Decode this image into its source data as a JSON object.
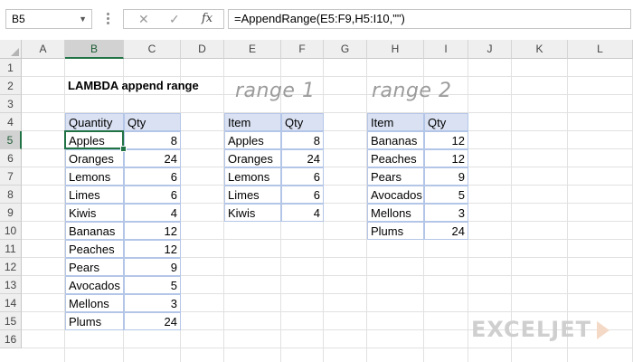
{
  "formula_bar": {
    "name_box": "B5",
    "cancel": "✕",
    "enter": "✓",
    "fx": "fx",
    "formula": "=AppendRange(E5:F9,H5:I10,\"\")"
  },
  "sheet": {
    "columns": [
      "A",
      "B",
      "C",
      "D",
      "E",
      "F",
      "G",
      "H",
      "I",
      "J",
      "K",
      "L"
    ],
    "rows": [
      "1",
      "2",
      "3",
      "4",
      "5",
      "6",
      "7",
      "8",
      "9",
      "10",
      "11",
      "12",
      "13",
      "14",
      "15",
      "16"
    ],
    "selected_column": "B",
    "selected_row": "5",
    "title": "LAMBDA append range",
    "range1_label": "range 1",
    "range2_label": "range 2"
  },
  "result_table": {
    "headers": [
      "Quantity",
      "Qty"
    ],
    "rows": [
      [
        "Apples",
        "8"
      ],
      [
        "Oranges",
        "24"
      ],
      [
        "Lemons",
        "6"
      ],
      [
        "Limes",
        "6"
      ],
      [
        "Kiwis",
        "4"
      ],
      [
        "Bananas",
        "12"
      ],
      [
        "Peaches",
        "12"
      ],
      [
        "Pears",
        "9"
      ],
      [
        "Avocados",
        "5"
      ],
      [
        "Mellons",
        "3"
      ],
      [
        "Plums",
        "24"
      ]
    ]
  },
  "range1_table": {
    "headers": [
      "Item",
      "Qty"
    ],
    "rows": [
      [
        "Apples",
        "8"
      ],
      [
        "Oranges",
        "24"
      ],
      [
        "Lemons",
        "6"
      ],
      [
        "Limes",
        "6"
      ],
      [
        "Kiwis",
        "4"
      ]
    ]
  },
  "range2_table": {
    "headers": [
      "Item",
      "Qty"
    ],
    "rows": [
      [
        "Bananas",
        "12"
      ],
      [
        "Peaches",
        "12"
      ],
      [
        "Pears",
        "9"
      ],
      [
        "Avocados",
        "5"
      ],
      [
        "Mellons",
        "3"
      ],
      [
        "Plums",
        "24"
      ]
    ]
  },
  "watermark": {
    "text": "EXCELJET"
  },
  "colors": {
    "header_fill": "#d9e1f2",
    "table_border": "#b4c6e7",
    "selection": "#217346",
    "logo_accent": "#f4d9c6"
  }
}
